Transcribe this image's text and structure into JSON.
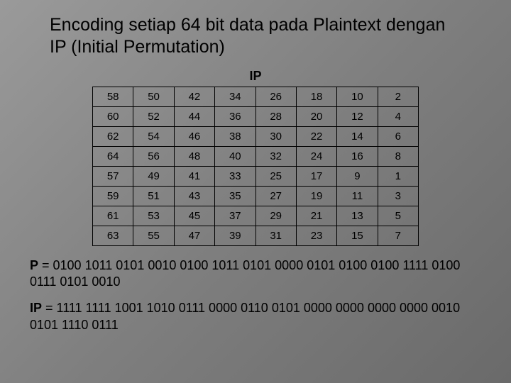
{
  "title": "Encoding setiap 64 bit data pada Plaintext dengan IP (Initial Permutation)",
  "table": {
    "caption": "IP",
    "rows": [
      [
        58,
        50,
        42,
        34,
        26,
        18,
        10,
        2
      ],
      [
        60,
        52,
        44,
        36,
        28,
        20,
        12,
        4
      ],
      [
        62,
        54,
        46,
        38,
        30,
        22,
        14,
        6
      ],
      [
        64,
        56,
        48,
        40,
        32,
        24,
        16,
        8
      ],
      [
        57,
        49,
        41,
        33,
        25,
        17,
        9,
        1
      ],
      [
        59,
        51,
        43,
        35,
        27,
        19,
        11,
        3
      ],
      [
        61,
        53,
        45,
        37,
        29,
        21,
        13,
        5
      ],
      [
        63,
        55,
        47,
        39,
        31,
        23,
        15,
        7
      ]
    ]
  },
  "p_label": "P",
  "p_value": " = 0100 1011 0101 0010 0100 1011 0101 0000 0101 0100 0100 1111 0100 0111 0101 0010",
  "ip_label": "IP",
  "ip_value": " = 1111 1111 1001 1010 0111 0000 0110 0101 0000 0000 0000 0000 0010 0101 1110 0111"
}
